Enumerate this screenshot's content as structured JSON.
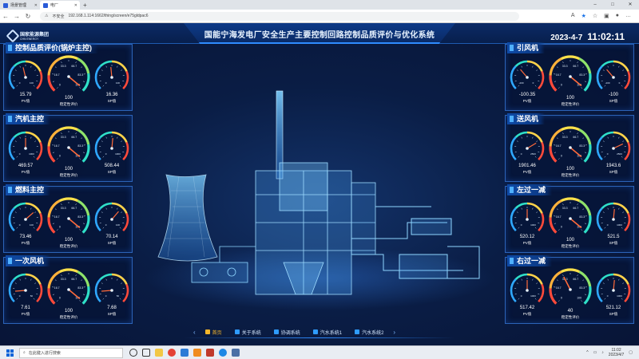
{
  "browser": {
    "tabs": [
      {
        "label": "场景管理",
        "active": false
      },
      {
        "label": "电厂",
        "active": true
      }
    ],
    "new_tab": "+",
    "window_buttons": [
      "–",
      "□",
      "✕"
    ],
    "security_label": "不安全",
    "url": "192.168.1.114:1662/thing/screen/e75gldpac6"
  },
  "header": {
    "logo_cn": "国家能源集团",
    "logo_en": "CHN ENERGY",
    "title": "国能宁海发电厂安全生产主要控制回路控制品质评价与优化系统",
    "date": "2023-4-7",
    "time": "11:02:11"
  },
  "panels_left": [
    {
      "title": "控制品质评价(锅炉主控)",
      "pv": "15.79",
      "score": "100",
      "sp": "16.36",
      "pv_label": "PV值",
      "score_label": "稳定性评价",
      "sp_label": "SP值",
      "g1": [
        0.45,
        "0",
        "100"
      ],
      "g2": [
        0.98,
        "0",
        "100"
      ],
      "g3": [
        0.48,
        "0",
        "100"
      ]
    },
    {
      "title": "汽机主控",
      "pv": "469.57",
      "score": "100",
      "sp": "508.44",
      "pv_label": "PV值",
      "score_label": "稳定性评价",
      "sp_label": "SP值",
      "g1": [
        0.5,
        "0",
        "1000"
      ],
      "g2": [
        0.98,
        "0",
        "100"
      ],
      "g3": [
        0.52,
        "0",
        "1000"
      ]
    },
    {
      "title": "燃料主控",
      "pv": "73.46",
      "score": "100",
      "sp": "70.14",
      "pv_label": "PV值",
      "score_label": "稳定性评价",
      "sp_label": "SP值",
      "g1": [
        0.68,
        "0",
        "100"
      ],
      "g2": [
        0.98,
        "0",
        "100"
      ],
      "g3": [
        0.65,
        "0",
        "100"
      ]
    },
    {
      "title": "一次风机",
      "pv": "7.61",
      "score": "100",
      "sp": "7.68",
      "pv_label": "PV值",
      "score_label": "稳定性评价",
      "sp_label": "SP值",
      "g1": [
        0.15,
        "0",
        "50"
      ],
      "g2": [
        0.98,
        "0",
        "100"
      ],
      "g3": [
        0.15,
        "0",
        "50"
      ]
    }
  ],
  "panels_right": [
    {
      "title": "引风机",
      "pv": "-100.35",
      "score": "100",
      "sp": "-100",
      "pv_label": "PV值",
      "score_label": "稳定性评价",
      "sp_label": "SP值",
      "g1": [
        0.35,
        "-200",
        "0"
      ],
      "g2": [
        0.98,
        "0",
        "100"
      ],
      "g3": [
        0.35,
        "-200",
        "0"
      ]
    },
    {
      "title": "送风机",
      "pv": "1901.46",
      "score": "100",
      "sp": "1943.6",
      "pv_label": "PV值",
      "score_label": "稳定性评价",
      "sp_label": "SP值",
      "g1": [
        0.72,
        "0",
        "2500"
      ],
      "g2": [
        0.98,
        "0",
        "100"
      ],
      "g3": [
        0.74,
        "0",
        "2500"
      ]
    },
    {
      "title": "左过一减",
      "pv": "520.12",
      "score": "100",
      "sp": "521.5",
      "pv_label": "PV值",
      "score_label": "稳定性评价",
      "sp_label": "SP值",
      "g1": [
        0.5,
        "0",
        "1000"
      ],
      "g2": [
        0.98,
        "0",
        "100"
      ],
      "g3": [
        0.52,
        "0",
        "1000"
      ]
    },
    {
      "title": "右过一减",
      "pv": "517.42",
      "score": "40",
      "sp": "521.12",
      "pv_label": "PV值",
      "score_label": "稳定性评价",
      "sp_label": "SP值",
      "g1": [
        0.5,
        "0",
        "1000"
      ],
      "g2": [
        0.4,
        "0",
        "100"
      ],
      "g3": [
        0.52,
        "0",
        "1000"
      ]
    }
  ],
  "gauge_inner": {
    "left": "16.7",
    "mid": "33.3",
    "right": "66.7",
    "far": "83.3"
  },
  "bottom_nav": {
    "prev": "‹",
    "next": "›",
    "items": [
      {
        "label": "首页",
        "active": true
      },
      {
        "label": "关于系统",
        "active": false
      },
      {
        "label": "协调系统",
        "active": false
      },
      {
        "label": "汽水系统1",
        "active": false
      },
      {
        "label": "汽水系统2",
        "active": false
      }
    ]
  },
  "taskbar": {
    "search_placeholder": "在此键入进行搜索",
    "clock_time": "11:02",
    "clock_date": "2023/4/7"
  },
  "colors": {
    "accent": "#2f8cff",
    "active_nav": "#f5b62a",
    "panel_border": "#2c63b8"
  }
}
